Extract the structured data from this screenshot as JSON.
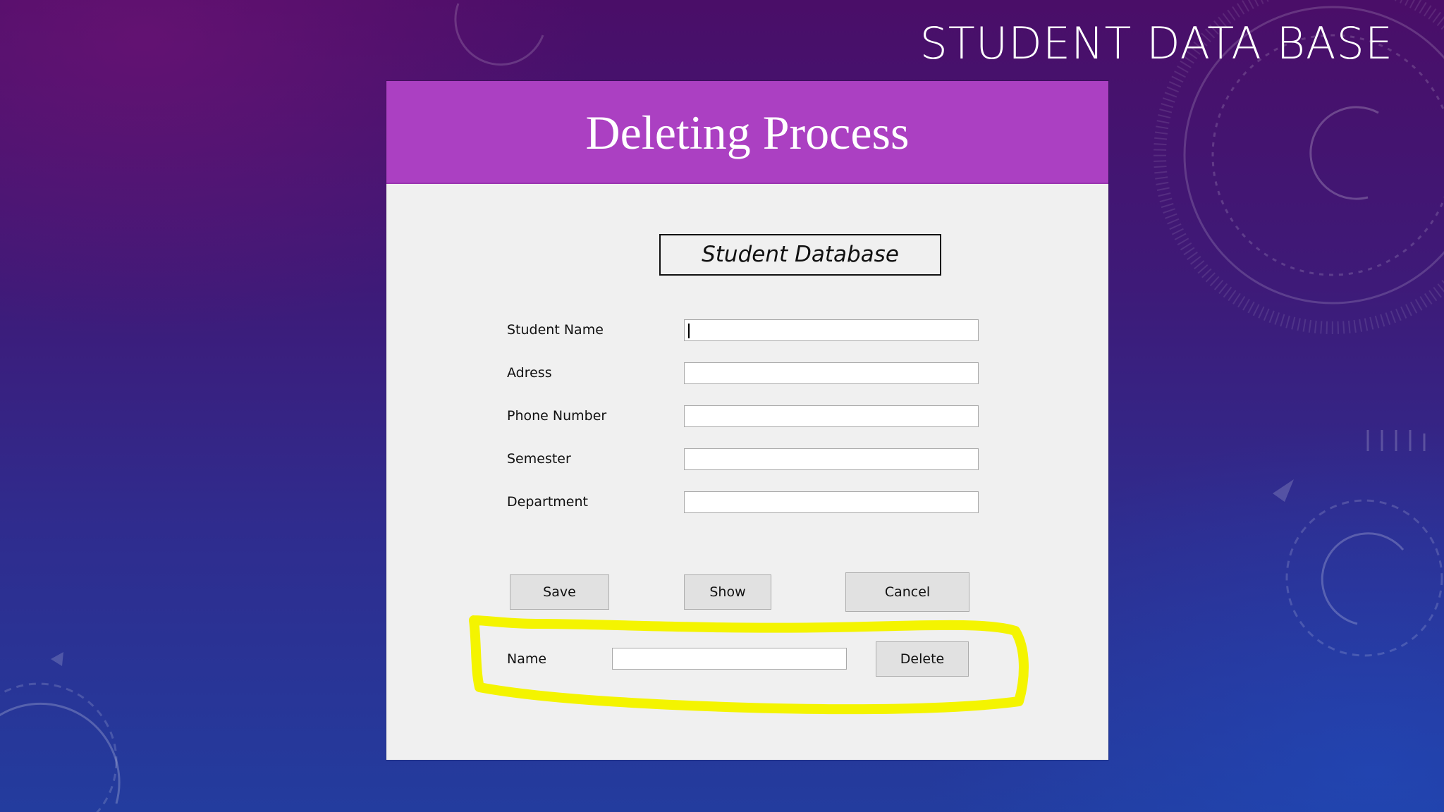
{
  "slide": {
    "title": "STUDENT DATA BASE"
  },
  "window": {
    "header_title": "Deleting Process",
    "db_label": "Student Database"
  },
  "form": {
    "fields": [
      {
        "label": "Student Name",
        "value": ""
      },
      {
        "label": "Adress",
        "value": ""
      },
      {
        "label": "Phone Number",
        "value": ""
      },
      {
        "label": "Semester",
        "value": ""
      },
      {
        "label": "Department",
        "value": ""
      }
    ],
    "buttons": {
      "save": "Save",
      "show": "Show",
      "cancel": "Cancel"
    }
  },
  "delete_section": {
    "label": "Name",
    "value": "",
    "button": "Delete"
  },
  "colors": {
    "header_bg": "#ab40c2",
    "panel_bg": "#f0f0f0",
    "highlight": "#f4f400"
  }
}
